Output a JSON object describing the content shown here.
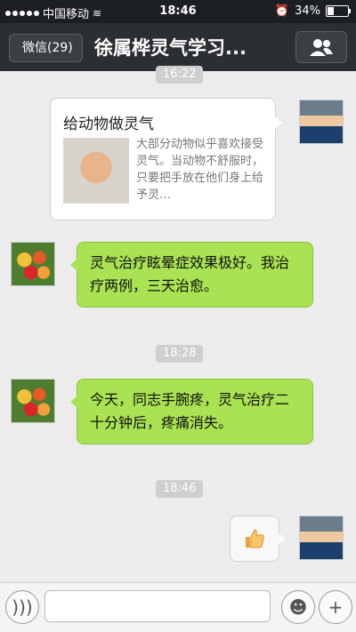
{
  "status_bar": {
    "carrier": "中国移动",
    "time": "18:46",
    "battery": "34%",
    "battery_level_percent": 34
  },
  "nav": {
    "back_label": "微信(29)",
    "title": "徐属桦灵气学习..."
  },
  "messages": [
    {
      "type": "time",
      "text": "16:22"
    },
    {
      "type": "card",
      "sender": "self",
      "title": "给动物做灵气",
      "description": "大部分动物似乎喜欢接受灵气。当动物不舒服时，只要把手放在他们身上给予灵…"
    },
    {
      "type": "text",
      "sender": "other",
      "text": "灵气治疗眩晕症效果极好。我治疗两例，三天治愈。"
    },
    {
      "type": "time",
      "text": "18:28"
    },
    {
      "type": "text",
      "sender": "other",
      "text": "今天，同志手腕疼，灵气治疗二十分钟后，疼痛消失。"
    },
    {
      "type": "time",
      "text": "18:46"
    },
    {
      "type": "emoji",
      "sender": "self",
      "icon": "thumbs-up-icon"
    }
  ],
  "input": {
    "placeholder": ""
  },
  "colors": {
    "nav_bg": "#2b2f33",
    "bubble_green": "#a9e253",
    "chat_bg": "#ececec"
  }
}
